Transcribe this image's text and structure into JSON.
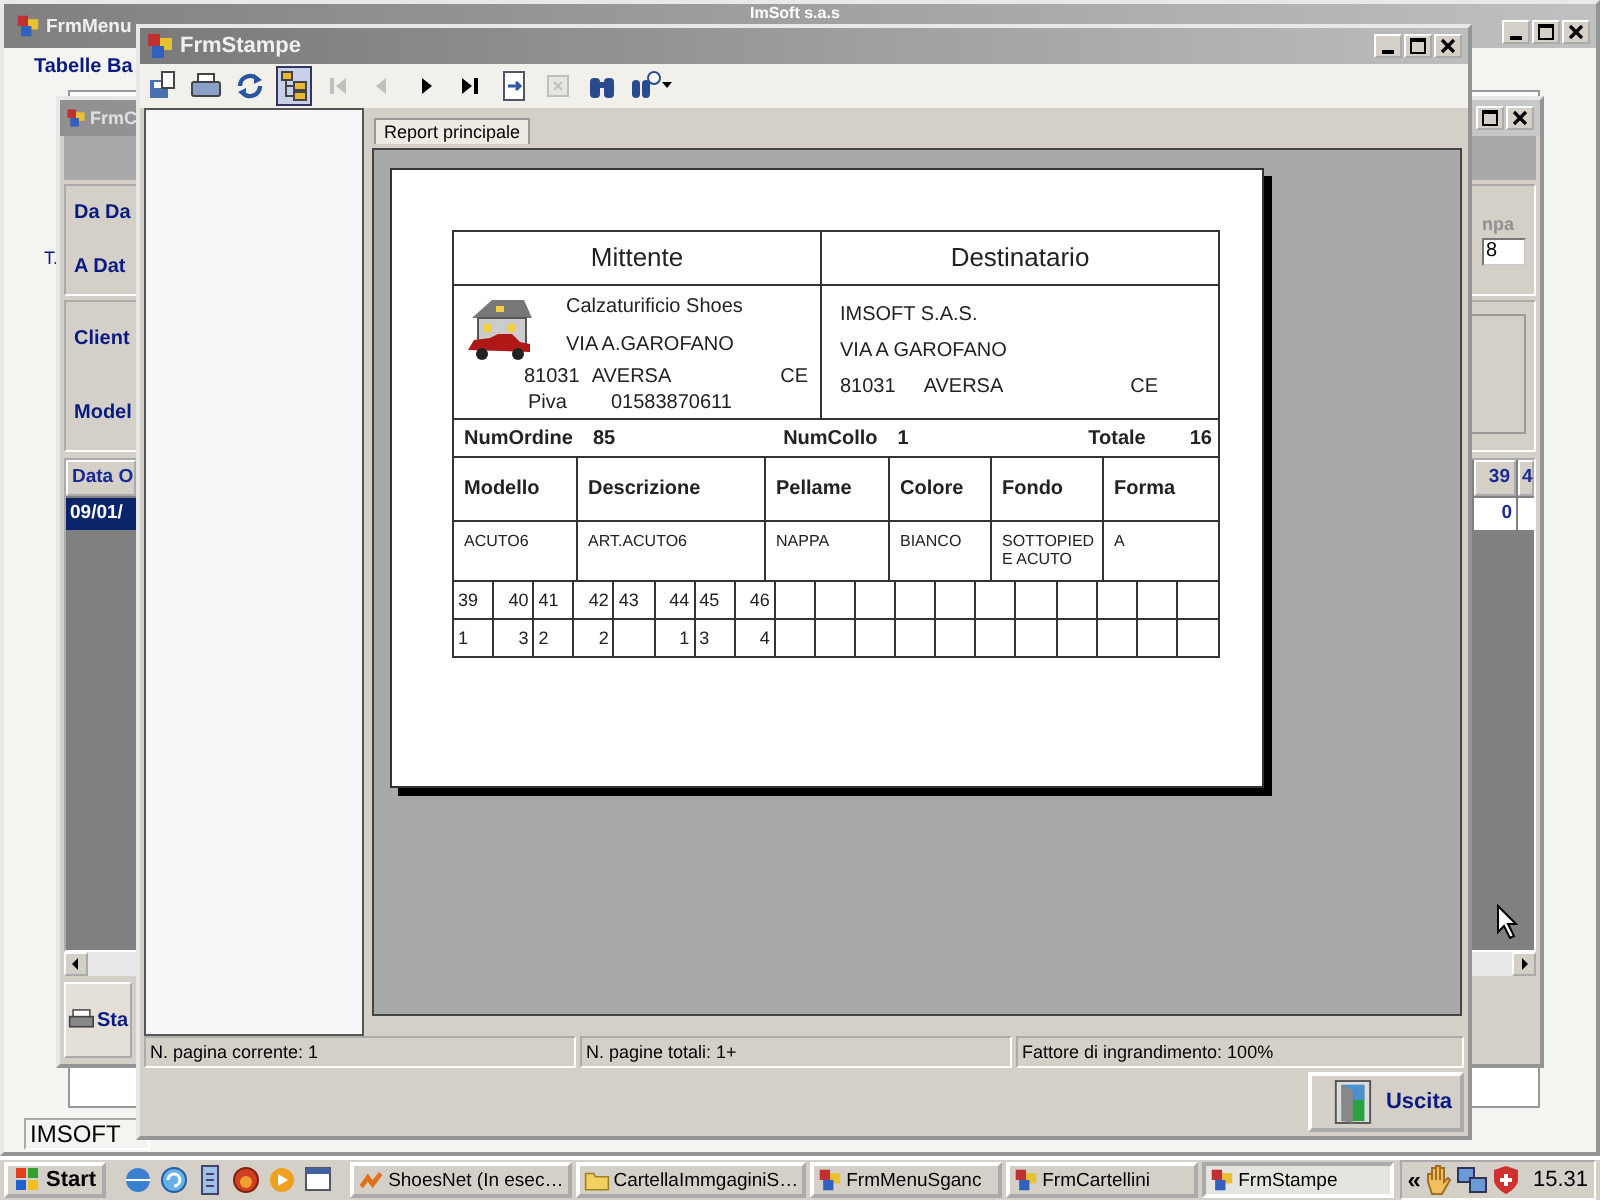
{
  "back_window": {
    "title": "FrmMenu",
    "app_title": "ImSoft s.a.s",
    "menu_label": "Tabelle Ba",
    "side_text": "T.",
    "status": "IMSOFT"
  },
  "middle_window": {
    "title": "FrmC",
    "labels": [
      "Da Da",
      "A Dat",
      "Client",
      "Model"
    ],
    "right_label": "npa",
    "right_field_value": "8",
    "grid_header": "Data O",
    "grid_row": "09/01/",
    "right_columns": [
      "39",
      "4"
    ],
    "right_row_value": "0",
    "print_button": "Sta"
  },
  "window": {
    "title": "FrmStampe"
  },
  "toolbar": [
    {
      "kind": "export",
      "disabled": false,
      "selected": false
    },
    {
      "kind": "print",
      "disabled": false,
      "selected": false
    },
    {
      "kind": "refresh",
      "disabled": false,
      "selected": false
    },
    {
      "kind": "tree",
      "disabled": false,
      "selected": true
    },
    {
      "kind": "first",
      "disabled": true,
      "selected": false
    },
    {
      "kind": "prev",
      "disabled": true,
      "selected": false
    },
    {
      "kind": "next",
      "disabled": false,
      "selected": false
    },
    {
      "kind": "last",
      "disabled": false,
      "selected": false
    },
    {
      "kind": "goto",
      "disabled": false,
      "selected": false
    },
    {
      "kind": "stop",
      "disabled": true,
      "selected": false
    },
    {
      "kind": "find",
      "disabled": false,
      "selected": false
    },
    {
      "kind": "zoom",
      "disabled": false,
      "selected": false
    }
  ],
  "tab": {
    "label": "Report principale"
  },
  "report": {
    "sender_heading": "Mittente",
    "recipient_heading": "Destinatario",
    "sender": {
      "name": "Calzaturificio Shoes",
      "street": "VIA A.GAROFANO",
      "zip": "81031",
      "city": "AVERSA",
      "province": "CE",
      "vat_label": "Piva",
      "vat": "01583870611"
    },
    "recipient": {
      "name": "IMSOFT S.A.S.",
      "street": "VIA A GAROFANO",
      "zip": "81031",
      "city": "AVERSA",
      "province": "CE"
    },
    "order_label": "NumOrdine",
    "order": "85",
    "parcel_label": "NumCollo",
    "parcel": "1",
    "total_label": "Totale",
    "total": "16",
    "columns": [
      "Modello",
      "Descrizione",
      "Pellame",
      "Colore",
      "Fondo",
      "Forma"
    ],
    "values": [
      "ACUTO6",
      "ART.ACUTO6",
      "NAPPA",
      "BIANCO",
      "SOTTOPIED E ACUTO",
      "A"
    ],
    "sizes": [
      {
        "size": "39",
        "qty": "1"
      },
      {
        "size": "40",
        "qty": "3"
      },
      {
        "size": "41",
        "qty": "2"
      },
      {
        "size": "42",
        "qty": "2"
      },
      {
        "size": "43"
      },
      {
        "size": "44",
        "qty": "1"
      },
      {
        "size": "45",
        "qty": "3"
      },
      {
        "size": "46",
        "qty": "4"
      }
    ]
  },
  "status_bar": [
    "N. pagina corrente: 1",
    "N. pagine totali: 1+",
    "Fattore di ingrandimento: 100%"
  ],
  "exit_button": "Uscita",
  "taskbar": {
    "start": "Start",
    "tasks": [
      {
        "label": "ShoesNet (In esec…",
        "kind": "app",
        "selected": false
      },
      {
        "label": "CartellaImmgaginiS…",
        "kind": "folder",
        "selected": false
      },
      {
        "label": "FrmMenuSganc",
        "kind": "form",
        "selected": false
      },
      {
        "label": "FrmCartellini",
        "kind": "form",
        "selected": false
      },
      {
        "label": "FrmStampe",
        "kind": "form",
        "selected": true
      }
    ],
    "tray_expand": "«",
    "clock": "15.31"
  }
}
